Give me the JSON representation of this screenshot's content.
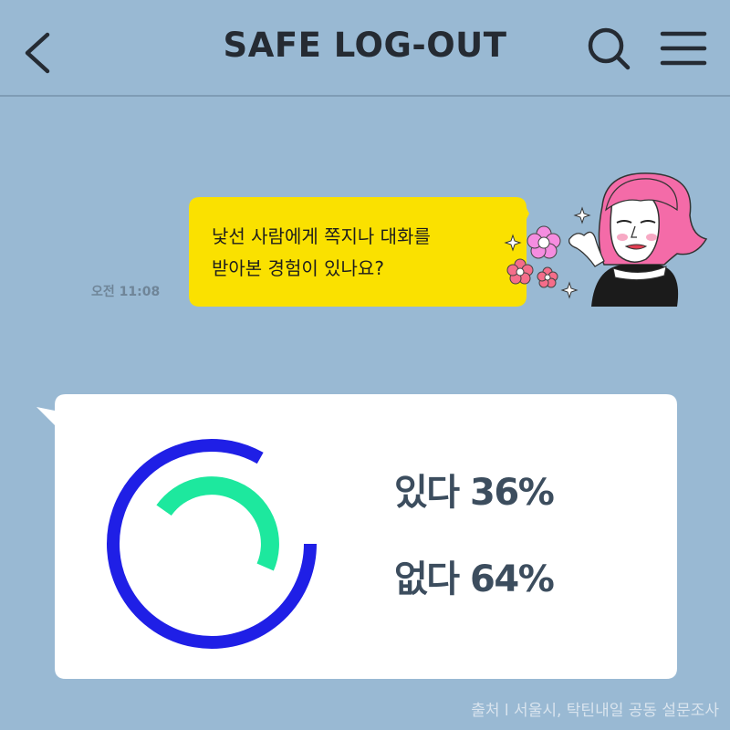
{
  "header": {
    "title": "SAFE LOG-OUT",
    "back_icon": "chevron-left-icon",
    "search_icon": "search-icon",
    "menu_icon": "hamburger-menu-icon"
  },
  "message": {
    "timestamp": "오전 11:08",
    "lines": [
      "낯선 사람에게 쪽지나 대화를",
      "받아본 경험이 있나요?"
    ],
    "bubble_color": "#fae100"
  },
  "chart_data": {
    "type": "pie",
    "categories": [
      "있다",
      "없다"
    ],
    "values": [
      36,
      64
    ],
    "colors": [
      "#1de89e",
      "#1f1fe6"
    ]
  },
  "results": {
    "yes": "있다 36%",
    "no": "없다 64%"
  },
  "source": "출처 l 서울시, 탁틴내일 공동 설문조사",
  "colors": {
    "background": "#99b9d3",
    "card": "#ffffff",
    "text_dark": "#3c4d5e"
  }
}
